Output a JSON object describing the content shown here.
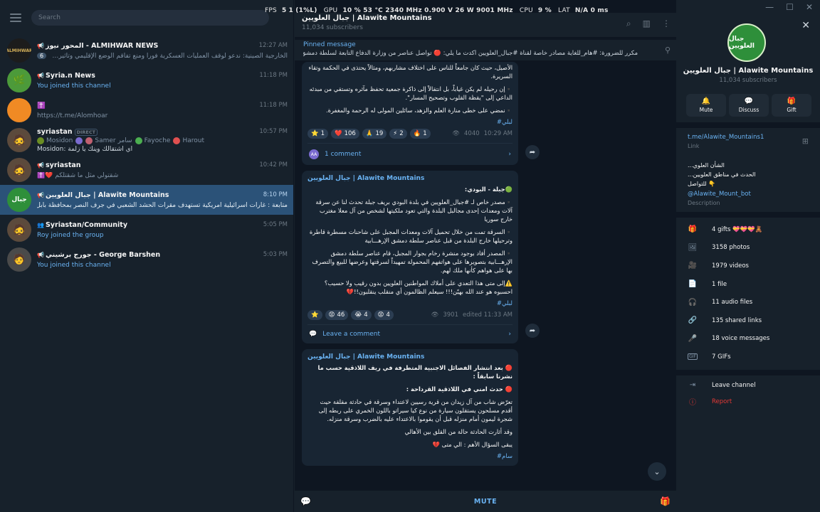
{
  "perf": {
    "fps_label": "FPS",
    "fps": "5",
    "fps2": "1 (1%L)",
    "gpu_label": "GPU",
    "gpu": "10 % 53 °C 2340 MHz 0.900 V 26 W 9001 MHz",
    "cpu_label": "CPU",
    "cpu": "9 %",
    "lat_label": "LAT",
    "lat": "N/A 0 ms"
  },
  "sidebar": {
    "search_placeholder": "Search",
    "chats": [
      {
        "name": "المحور نيوز - ALMIHWAR NEWS",
        "time": "12:27 AM",
        "badge": "6",
        "msg": "الخارجية الصينية: ندعو لوقف العمليات العسكرية فورا ومنع تفاقم الوضع الإقليمي وتأثيره على الاقتصاد...",
        "avatar_text": "ALMIHWAR",
        "avatar_color": "#1c1c1c"
      },
      {
        "name": "Syria.n News",
        "time": "11:18 PM",
        "msg": "You joined this channel",
        "avatar_text": "",
        "avatar_color": "#4c9a3a"
      },
      {
        "name": "✝️",
        "time": "11:18 PM",
        "msg": "https://t.me/Alomhoar",
        "avatar_text": "",
        "avatar_color": "#f08a24"
      },
      {
        "name": "syriastan",
        "tag": "DIRECT",
        "time": "10:57 PM",
        "chips": [
          "Mosidon",
          "Samer سامر",
          "Fayoche",
          "Harout"
        ],
        "msg": "Mosidon: اي اشتقالك وينك يا زلمة",
        "avatar_text": "",
        "avatar_color": "#5c4a3c"
      },
      {
        "name": "syriastan",
        "time": "10:42 PM",
        "msg": "✝️❤️ شقتولي مثل ما شقتلكم",
        "avatar_text": "",
        "avatar_color": "#5c4a3c"
      },
      {
        "name": "جبال العلويين | Alawite Mountains",
        "time": "8:10 PM",
        "msg": "متابعة : غارات اسرائيلية امريكية تستهدف مقرات الحشد الشعبي في جرف النصر بمحافظة بابل . #رعد",
        "avatar_text": "جبال",
        "avatar_color": "#2e8f3a"
      },
      {
        "name": "Syriastan/Community",
        "time": "5:05 PM",
        "msg": "Roy joined the group",
        "avatar_text": "",
        "avatar_color": "#5c4a3c"
      },
      {
        "name": "جورج برشيني - George Barshen",
        "time": "5:03 PM",
        "msg": "You joined this channel",
        "avatar_text": "",
        "avatar_color": "#4a4a4a"
      }
    ]
  },
  "main": {
    "title": "جبال العلويين | Alawite Mountains",
    "subscribers": "11,034 subscribers",
    "pinned_title": "Pinned message",
    "pinned_text": "مكرر للضرورة: #هام_للغاية   مصادر خاصة لقناة #جبال_العلويين أكدت ما يلي: 🔴 تواصل عناصر من وزارة الدفاع التابعة لسلطة دمشق الإرهـ...",
    "post1": {
      "lines": [
        "الأصيل، حيث كان جامعاً للناس على اختلاف مشاربهم، ومثالاً يحتذى في الحكمة وتقاء السريرة.",
        "▪️إن رحيله لم يكن غياباً، بل انتقالاً إلى ذاكرة جمعية تحفظ مآثره وتستقي من مبدئه الداعي إلى \"يقظة القلوب وتصحيح المسار\".",
        "▪️نمضي على خطى منارة العلم والزهد، سائلين المولى له الرحمة والمغفرة."
      ],
      "hashtag": "#لبلي",
      "reactions": [
        {
          "e": "⭐",
          "n": "1"
        },
        {
          "e": "❤️",
          "n": "106"
        },
        {
          "e": "🙏",
          "n": "19"
        },
        {
          "e": "⚡",
          "n": "2"
        },
        {
          "e": "🔥",
          "n": "1"
        }
      ],
      "views": "4040",
      "time": "10:29 AM",
      "comments": "1 comment"
    },
    "post2": {
      "author": "جبال العلويين | Alawite Mountains",
      "lines": [
        "🟢جبلة - البودي:",
        "▪️مصدر خاص لـ #جبال_العلويين في بلدة البودي بريف جبلة تحدث لنا عن سرقة آلات ومعدات إحدى مجالبل البلدة والتي تعود ملكيتها لشخص من آل معلا مغترب خارج سوريا",
        "▪️السرقة تمت من خلال تحميل آلات ومعدات المجبل على شاحنات مسطرة قاطرة وترحيلها خارج البلدة من قبل عناصر سلطة دمشق الإرهـــابية",
        "▪️المصدر أفاد بوجود منشرة رخام بجوار المجبل، قام عناصر سلطة دمشق الإرهـــابية بتصويرها على هواتفهم المحمولة تمهيداً لسرقتها وعرضها للبيع والتصرف بها على هواهم كأنها ملك لهم.",
        "⚠️إلى متى هذا التعدي على أملاك المواطنين العلويين بدون رقيب ولا حسيب؟ احسبوه هو عند الله بهيّن!!! سيعلم الظالمون أي منقلب ينقلبون!!💔"
      ],
      "hashtag": "#لبلي",
      "reactions": [
        {
          "e": "⭐",
          "n": ""
        },
        {
          "e": "😡",
          "n": "46"
        },
        {
          "e": "😭",
          "n": "4"
        },
        {
          "e": "😡",
          "n": "4"
        }
      ],
      "views": "3901",
      "time": "edited 11:33 AM",
      "comments": "Leave a comment"
    },
    "post3": {
      "author": "جبال العلويين | Alawite Mountains",
      "lines": [
        "🔴 بعد انتشار الفصائل الاجنبية المتطرفة في ريف اللاذقية حسب ما نشرنا سابقاً :",
        "🔴 حدث امني في اللاذقية القرداحة :",
        "تعرّض شاب من آل زيدان من قرية رسيين  لاعتداء وسرقة في حادثة مقلقة حيث أقدم مسلحون يستقلون سيارة من نوع كيا سيراتو باللون الخمري على ربطه إلى شجرة ليمون أمام منزله قبل أن يقوموا بالاعتداء عليه بالضرب وسرقة منزله.",
        "وقد أثارت الحادثة حالة من القلق بين الأهالي",
        "يبقى السؤال الأهم : الي متى 💔"
      ],
      "hashtag": "#سام"
    },
    "mute_label": "MUTE"
  },
  "panel": {
    "name": "جبال العلويين | Alawite Mountains",
    "subscribers": "11,034 subscribers",
    "avatar_text": "جبال العلويين",
    "actions": [
      {
        "label": "Mute",
        "icon": "🔔"
      },
      {
        "label": "Discuss",
        "icon": "💬"
      },
      {
        "label": "Gift",
        "icon": "🎁"
      }
    ],
    "link": "t.me/Alawite_Mountains1",
    "link_label": "Link",
    "description_lines": [
      "الشأن العلوي...",
      "الحدث في مناطق العلويين...",
      "👇 للتواصل"
    ],
    "handle": "@Alawite_Mount_bot",
    "description_label": "Description",
    "stats": [
      {
        "icon": "🎁",
        "label": "4 gifts 💝💝💝🧸"
      },
      {
        "icon": "🖼",
        "label": "3158 photos"
      },
      {
        "icon": "🎥",
        "label": "1979 videos"
      },
      {
        "icon": "📄",
        "label": "1 file"
      },
      {
        "icon": "🎧",
        "label": "11 audio files"
      },
      {
        "icon": "🔗",
        "label": "135 shared links"
      },
      {
        "icon": "🎤",
        "label": "18 voice messages"
      },
      {
        "icon": "GIF",
        "label": "7 GIFs"
      }
    ],
    "leave_label": "Leave channel",
    "report_label": "Report"
  },
  "colors": {
    "accent": "#6ab3f3",
    "active_chat": "#2b5278",
    "bg": "#17212b",
    "chat_bg": "#0e1621",
    "bubble": "#182533",
    "danger": "#e53935"
  }
}
